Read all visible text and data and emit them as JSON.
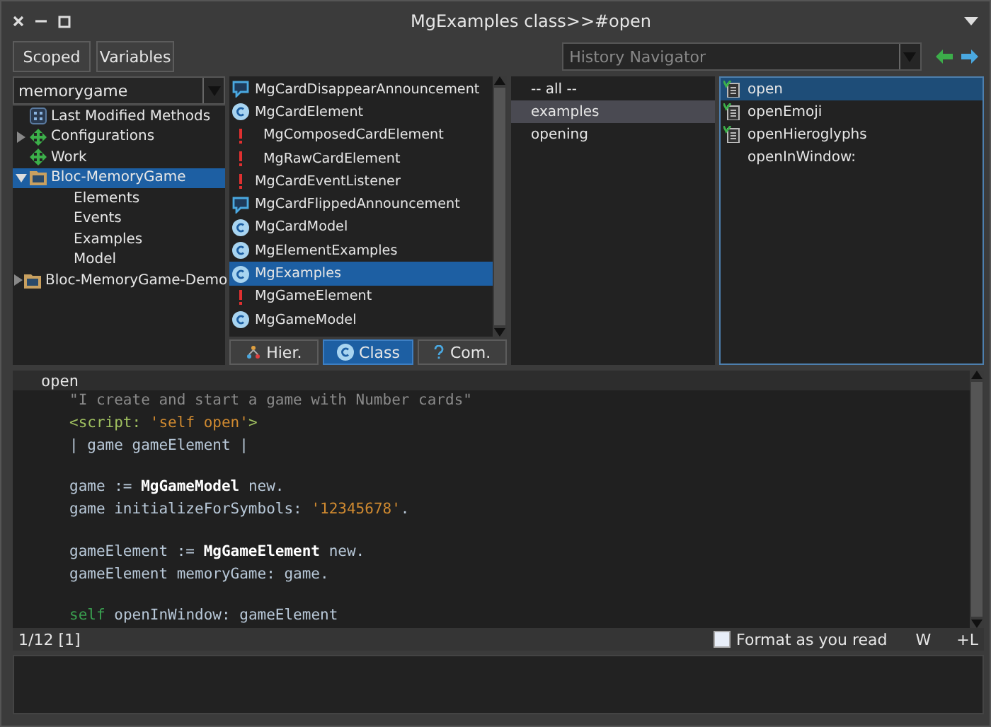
{
  "window": {
    "title": "MgExamples class>>#open"
  },
  "toolbar": {
    "buttons": [
      {
        "label": "Scoped"
      },
      {
        "label": "Variables"
      }
    ],
    "history": {
      "placeholder": "History Navigator"
    }
  },
  "packages": {
    "filter": {
      "value": "memorygame"
    },
    "items": [
      {
        "label": "Last Modified Methods",
        "kind": "recent",
        "selected": false
      },
      {
        "label": "Configurations",
        "kind": "config",
        "expanded": false,
        "selected": false
      },
      {
        "label": "Work",
        "kind": "config",
        "selected": false
      },
      {
        "label": "Bloc-MemoryGame",
        "kind": "package",
        "expanded": true,
        "selected": true,
        "children": [
          {
            "label": "Elements",
            "selected": false
          },
          {
            "label": "Events",
            "selected": false
          },
          {
            "label": "Examples",
            "selected": false
          },
          {
            "label": "Model",
            "selected": false
          }
        ]
      },
      {
        "label": "Bloc-MemoryGame-Demo",
        "kind": "package",
        "expanded": false,
        "selected": false
      }
    ]
  },
  "classes": {
    "items": [
      {
        "label": "MgCardDisappearAnnouncement",
        "kind": "announcement",
        "selected": false
      },
      {
        "label": "MgCardElement",
        "kind": "class",
        "selected": false,
        "children": [
          {
            "label": "MgComposedCardElement",
            "kind": "error",
            "selected": false
          },
          {
            "label": "MgRawCardElement",
            "kind": "error",
            "selected": false
          }
        ]
      },
      {
        "label": "MgCardEventListener",
        "kind": "error",
        "selected": false
      },
      {
        "label": "MgCardFlippedAnnouncement",
        "kind": "announcement",
        "selected": false
      },
      {
        "label": "MgCardModel",
        "kind": "class",
        "selected": false
      },
      {
        "label": "MgElementExamples",
        "kind": "class",
        "selected": false
      },
      {
        "label": "MgExamples",
        "kind": "class",
        "selected": true
      },
      {
        "label": "MgGameElement",
        "kind": "error",
        "selected": false
      },
      {
        "label": "MgGameModel",
        "kind": "class",
        "selected": false
      }
    ],
    "modes": [
      {
        "label": "Hier.",
        "kind": "hierarchy",
        "selected": false
      },
      {
        "label": "Class",
        "kind": "class",
        "selected": true
      },
      {
        "label": "Com.",
        "kind": "comment",
        "selected": false
      }
    ]
  },
  "protocols": [
    {
      "label": "-- all --",
      "selected": false
    },
    {
      "label": "examples",
      "selected": true
    },
    {
      "label": "opening",
      "selected": false
    }
  ],
  "methods": [
    {
      "label": "open",
      "kind": "test",
      "selected": true
    },
    {
      "label": "openEmoji",
      "kind": "test",
      "selected": false
    },
    {
      "label": "openHieroglyphs",
      "kind": "test",
      "selected": false
    },
    {
      "label": "openInWindow:",
      "kind": "plain",
      "selected": false
    }
  ],
  "editor": {
    "selector": "open",
    "lines": [
      {
        "kind": "code",
        "segments": [
          {
            "kind": "comment",
            "text": "\"I create and start a game with Number cards\""
          }
        ]
      },
      {
        "kind": "code",
        "segments": [
          {
            "kind": "pragma",
            "text": "<script: "
          },
          {
            "kind": "string",
            "text": "'self open'"
          },
          {
            "kind": "pragma",
            "text": ">"
          }
        ]
      },
      {
        "kind": "code",
        "segments": [
          {
            "kind": "plain",
            "text": "| game gameElement |"
          }
        ]
      },
      {
        "kind": "blank"
      },
      {
        "kind": "code",
        "segments": [
          {
            "kind": "plain",
            "text": "game := "
          },
          {
            "kind": "global",
            "text": "MgGameModel"
          },
          {
            "kind": "plain",
            "text": " new."
          }
        ]
      },
      {
        "kind": "code",
        "segments": [
          {
            "kind": "plain",
            "text": "game initializeForSymbols: "
          },
          {
            "kind": "string",
            "text": "'12345678'"
          },
          {
            "kind": "plain",
            "text": "."
          }
        ]
      },
      {
        "kind": "blank"
      },
      {
        "kind": "code",
        "segments": [
          {
            "kind": "plain",
            "text": "gameElement := "
          },
          {
            "kind": "global",
            "text": "MgGameElement"
          },
          {
            "kind": "plain",
            "text": " new."
          }
        ]
      },
      {
        "kind": "code",
        "segments": [
          {
            "kind": "plain",
            "text": "gameElement memoryGame: game."
          }
        ]
      },
      {
        "kind": "blank"
      },
      {
        "kind": "code",
        "segments": [
          {
            "kind": "self",
            "text": "self"
          },
          {
            "kind": "plain",
            "text": " openInWindow: gameElement"
          }
        ]
      }
    ]
  },
  "status_bar": {
    "position": "1/12 [1]",
    "format_as_you_read": {
      "label": "Format as you read",
      "checked": false
    },
    "wrap": "W",
    "line_numbers": "+L"
  }
}
